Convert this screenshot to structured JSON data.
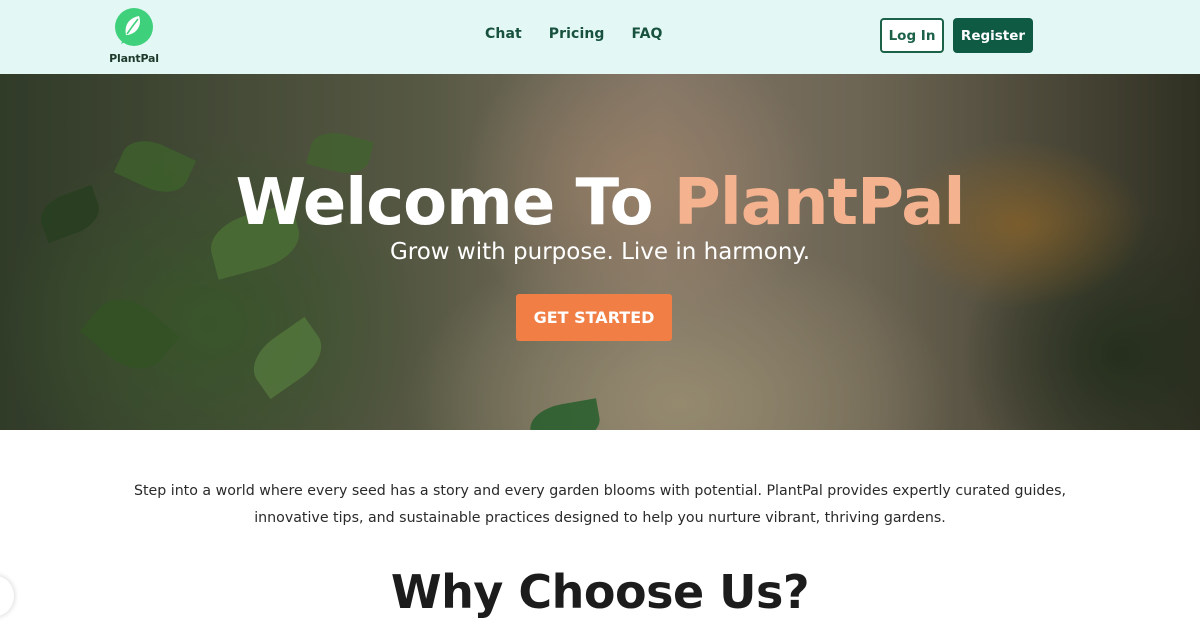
{
  "brand": {
    "name": "PlantPal",
    "logo_icon": "leaf-chat-bubble-icon",
    "logo_color": "#3fd07c"
  },
  "nav": {
    "items": [
      "Chat",
      "Pricing",
      "FAQ"
    ]
  },
  "auth": {
    "login_label": "Log In",
    "register_label": "Register"
  },
  "hero": {
    "title_main": "Welcome To ",
    "title_accent": "PlantPal",
    "subtitle": "Grow with purpose. Live in harmony.",
    "cta_label": "GET STARTED",
    "accent_color": "#f4b28f",
    "cta_color": "#f07e45"
  },
  "intro": {
    "line1": "Step into a world where every seed has a story and every garden blooms with potential. PlantPal provides expertly curated guides,",
    "line2": "innovative tips, and sustainable practices designed to help you nurture vibrant, thriving gardens."
  },
  "section": {
    "title": "Why Choose Us?"
  },
  "colors": {
    "header_bg": "#e3f8f4",
    "primary": "#0f5a43"
  }
}
